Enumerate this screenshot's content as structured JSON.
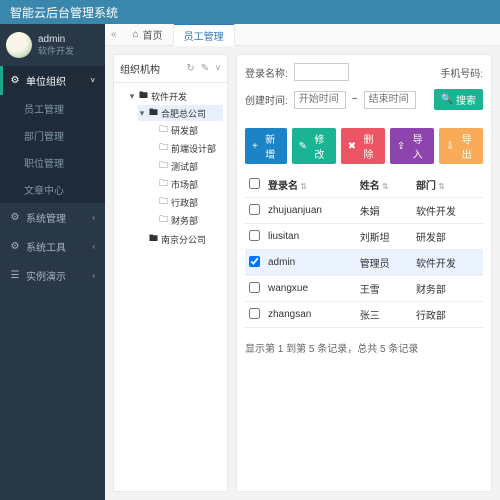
{
  "header": {
    "title": "智能云后台管理系统"
  },
  "user": {
    "name": "admin",
    "role": "软件开发"
  },
  "sidebar": {
    "groups": [
      {
        "icon": "⚙",
        "label": "单位组织",
        "open": true,
        "active": true,
        "items": [
          "员工管理",
          "部门管理",
          "职位管理",
          "文章中心"
        ]
      },
      {
        "icon": "⚙",
        "label": "系统管理",
        "open": false
      },
      {
        "icon": "⚙",
        "label": "系统工具",
        "open": false
      },
      {
        "icon": "☰",
        "label": "实例演示",
        "open": false
      }
    ]
  },
  "tabs": {
    "arrow_left": "«",
    "arrow_right": "»",
    "items": [
      {
        "label": "首页",
        "icon": "⌂",
        "active": false
      },
      {
        "label": "员工管理",
        "active": true
      }
    ]
  },
  "tree": {
    "title": "组织机构",
    "tools": [
      "↻",
      "✎",
      "˅"
    ],
    "root": {
      "label": "软件开发",
      "icon": "🖿",
      "open": true,
      "children": [
        {
          "label": "合肥总公司",
          "icon": "🖿",
          "open": true,
          "selected": true,
          "children": [
            {
              "label": "研发部",
              "icon": "🗀"
            },
            {
              "label": "前端设计部",
              "icon": "🗀"
            },
            {
              "label": "测试部",
              "icon": "🗀"
            },
            {
              "label": "市场部",
              "icon": "🗀"
            },
            {
              "label": "行政部",
              "icon": "🗀"
            },
            {
              "label": "财务部",
              "icon": "🗀"
            }
          ]
        },
        {
          "label": "南京分公司",
          "icon": "🖿",
          "open": false
        }
      ]
    }
  },
  "search": {
    "login_label": "登录名称:",
    "mobile_label": "手机号码:",
    "time_label": "创建时间:",
    "start_ph": "开始时间",
    "dash": "~",
    "end_ph": "结束时间",
    "search_btn": "搜索",
    "search_icon": "🔍"
  },
  "toolbar": {
    "add": {
      "icon": "+",
      "label": "新增"
    },
    "edit": {
      "icon": "✎",
      "label": "修改"
    },
    "del": {
      "icon": "✖",
      "label": "删除"
    },
    "import": {
      "icon": "⇪",
      "label": "导入"
    },
    "export": {
      "icon": "⇩",
      "label": "导出"
    }
  },
  "table": {
    "cols": {
      "chk": "",
      "login": "登录名",
      "name": "姓名",
      "dept": "部门"
    },
    "rows": [
      {
        "sel": false,
        "login": "zhujuanjuan",
        "name": "朱娟",
        "dept": "软件开发"
      },
      {
        "sel": false,
        "login": "liusitan",
        "name": "刘斯坦",
        "dept": "研发部"
      },
      {
        "sel": true,
        "login": "admin",
        "name": "管理员",
        "dept": "软件开发"
      },
      {
        "sel": false,
        "login": "wangxue",
        "name": "王雪",
        "dept": "财务部"
      },
      {
        "sel": false,
        "login": "zhangsan",
        "name": "张三",
        "dept": "行政部"
      }
    ]
  },
  "pager": {
    "text": "显示第 1 到第 5 条记录，总共 5 条记录"
  }
}
